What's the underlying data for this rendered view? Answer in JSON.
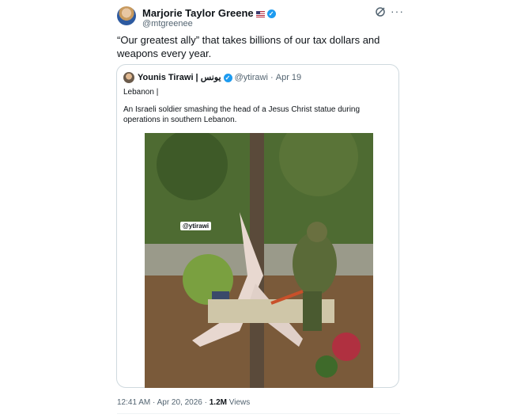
{
  "post": {
    "author_name": "Marjorie Taylor Greene",
    "handle": "@mtgreenee",
    "flag": "🇺🇸",
    "text": "“Our greatest ally” that takes billions of our tax dollars and weapons every year."
  },
  "quoted": {
    "author_name": "Younis Tirawi | يونس",
    "handle": "@ytirawi",
    "date": "Apr 19",
    "line1": "Lebanon |",
    "line2": "An Israeli soldier smashing the head of a Jesus Christ statue during operations in southern Lebanon.",
    "watermark": "@ytirawi"
  },
  "footer": {
    "timestamp": "12:41 AM · Apr 20, 2026 · ",
    "views_count": "1.2M",
    "views_label": " Views"
  },
  "colors": {
    "verified": "#1d9bf0",
    "secondary_text": "#536471",
    "border": "#cfd9de"
  },
  "icons": [
    "grok-icon",
    "more-icon",
    "verified-icon"
  ]
}
